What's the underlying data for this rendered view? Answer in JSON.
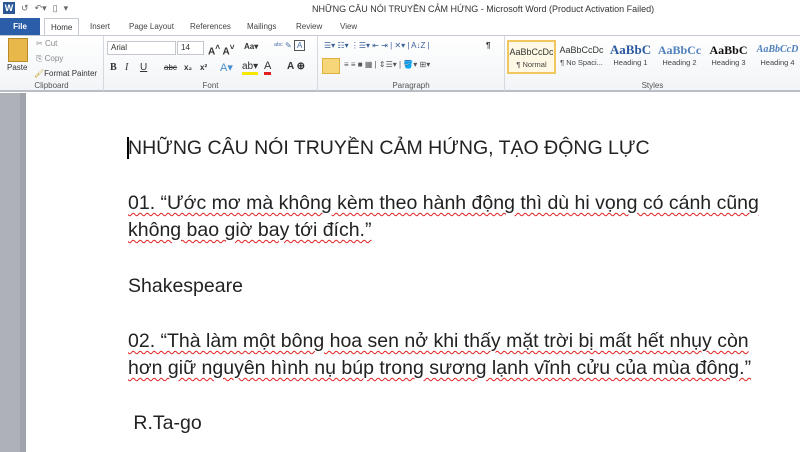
{
  "window": {
    "title": "NHỮNG CÂU NÓI TRUYỀN CẢM HỨNG  -  Microsoft Word (Product Activation Failed)",
    "app_icon": "W"
  },
  "tabs": [
    "File",
    "Home",
    "Insert",
    "Page Layout",
    "References",
    "Mailings",
    "Review",
    "View"
  ],
  "clipboard": {
    "paste": "Paste",
    "cut": "Cut",
    "copy": "Copy",
    "format_painter": "Format Painter",
    "label": "Clipboard"
  },
  "font": {
    "name": "Arial",
    "size": "14",
    "label": "Font",
    "bold": "B",
    "italic": "I",
    "underline": "U",
    "strike": "abc",
    "sub": "x₂",
    "sup": "x²"
  },
  "paragraph": {
    "label": "Paragraph",
    "pilcrow": "¶"
  },
  "styles": {
    "label": "Styles",
    "items": [
      {
        "preview": "AaBbCcDc",
        "name": "¶ Normal"
      },
      {
        "preview": "AaBbCcDc",
        "name": "¶ No Spaci..."
      },
      {
        "preview": "AaBbC",
        "name": "Heading 1"
      },
      {
        "preview": "AaBbCc",
        "name": "Heading 2"
      },
      {
        "preview": "AaBbC",
        "name": "Heading 3"
      },
      {
        "preview": "AaBbCcD",
        "name": "Heading 4"
      }
    ]
  },
  "document": {
    "title": "NHỮNG CÂU NÓI TRUYỀN CẢM HỨNG, TẠO ĐỘNG LỰC",
    "q1_line1": "01. “Ước mơ mà không kèm theo hành động thì dù hi vọng có cánh cũng",
    "q1_line2": "không bao giờ bay tới đích.”",
    "q1_author": "Shakespeare",
    "q2_line1": "02. “Thà làm một bông hoa sen nở khi thấy mặt trời bị mất hết nhụy còn",
    "q2_line2": "hơn giữ nguyên hình nụ búp trong sương lạnh vĩnh cửu của mùa đông.”",
    "q2_author": " R.Ta-go"
  }
}
